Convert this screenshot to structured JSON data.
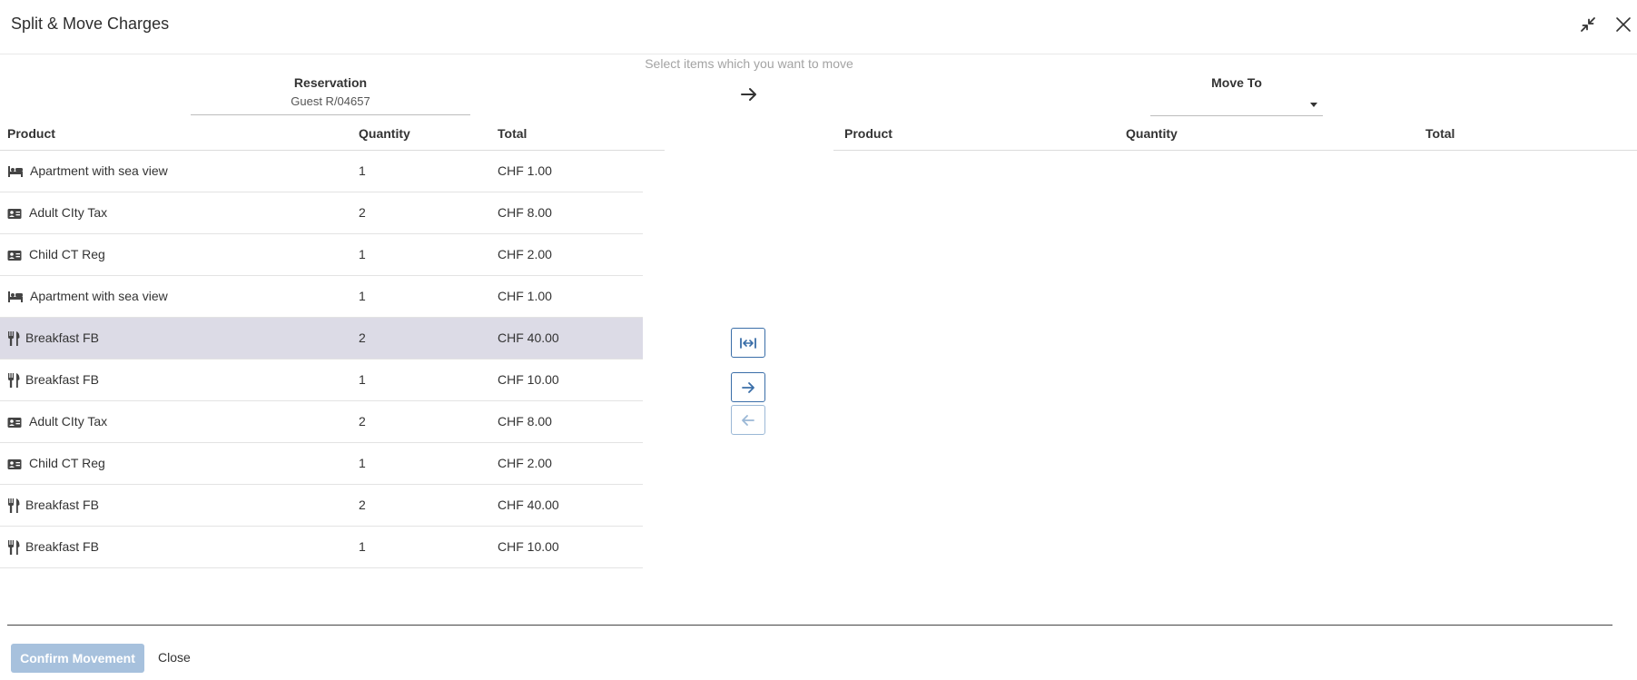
{
  "dialog": {
    "title": "Split & Move Charges"
  },
  "hint": "Select items which you want to move",
  "source": {
    "label": "Reservation",
    "value": "Guest R/04657",
    "columns": {
      "product": "Product",
      "quantity": "Quantity",
      "total": "Total"
    },
    "rows": [
      {
        "icon": "bed-icon",
        "product": "Apartment with sea view",
        "quantity": "1",
        "total": "CHF 1.00",
        "selected": false
      },
      {
        "icon": "id-card-icon",
        "product": "Adult CIty Tax",
        "quantity": "2",
        "total": "CHF 8.00",
        "selected": false
      },
      {
        "icon": "id-card-icon",
        "product": "Child CT Reg",
        "quantity": "1",
        "total": "CHF 2.00",
        "selected": false
      },
      {
        "icon": "bed-icon",
        "product": "Apartment with sea view",
        "quantity": "1",
        "total": "CHF 1.00",
        "selected": false
      },
      {
        "icon": "utensils-icon",
        "product": "Breakfast FB",
        "quantity": "2",
        "total": "CHF 40.00",
        "selected": true
      },
      {
        "icon": "utensils-icon",
        "product": "Breakfast FB",
        "quantity": "1",
        "total": "CHF 10.00",
        "selected": false
      },
      {
        "icon": "id-card-icon",
        "product": "Adult CIty Tax",
        "quantity": "2",
        "total": "CHF 8.00",
        "selected": false
      },
      {
        "icon": "id-card-icon",
        "product": "Child CT Reg",
        "quantity": "1",
        "total": "CHF 2.00",
        "selected": false
      },
      {
        "icon": "utensils-icon",
        "product": "Breakfast FB",
        "quantity": "2",
        "total": "CHF 40.00",
        "selected": false
      },
      {
        "icon": "utensils-icon",
        "product": "Breakfast FB",
        "quantity": "1",
        "total": "CHF 10.00",
        "selected": false
      }
    ]
  },
  "target": {
    "label": "Move To",
    "value": "",
    "columns": {
      "product": "Product",
      "quantity": "Quantity",
      "total": "Total"
    },
    "rows": []
  },
  "footer": {
    "confirm_label": "Confirm Movement",
    "close_label": "Close"
  },
  "colors": {
    "selected_row": "#dcdbe6",
    "accent": "#3a6ea8",
    "confirm_disabled": "#a7c1dd"
  }
}
